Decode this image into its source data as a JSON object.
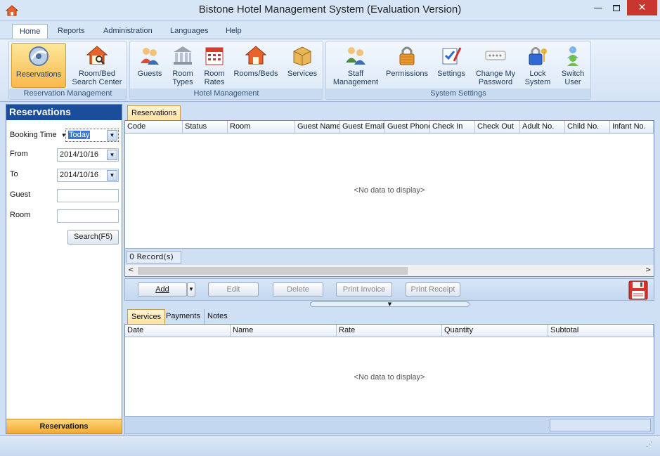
{
  "window": {
    "title": "Bistone Hotel Management System (Evaluation Version)",
    "min": "▭",
    "max": "▢",
    "close": "✕"
  },
  "menu": {
    "tabs": [
      {
        "label": "Home"
      },
      {
        "label": "Reports"
      },
      {
        "label": "Administration"
      },
      {
        "label": "Languages"
      },
      {
        "label": "Help"
      }
    ]
  },
  "ribbon": {
    "groups": [
      {
        "title": "Reservation Management",
        "buttons": [
          {
            "label": "Reservations"
          },
          {
            "label": "Room/Bed\nSearch Center"
          }
        ]
      },
      {
        "title": "Hotel Management",
        "buttons": [
          {
            "label": "Guests"
          },
          {
            "label": "Room\nTypes"
          },
          {
            "label": "Room\nRates"
          },
          {
            "label": "Rooms/Beds"
          },
          {
            "label": "Services"
          }
        ]
      },
      {
        "title": "System Settings",
        "buttons": [
          {
            "label": "Staff\nManagement"
          },
          {
            "label": "Permissions"
          },
          {
            "label": "Settings"
          },
          {
            "label": "Change My\nPassword"
          },
          {
            "label": "Lock\nSystem"
          },
          {
            "label": "Switch\nUser"
          }
        ]
      }
    ]
  },
  "left_panel": {
    "header": "Reservations",
    "booking_time_label": "Booking Time",
    "booking_time_value": "Today",
    "from_label": "From",
    "from_value": "2014/10/16",
    "to_label": "To",
    "to_value": "2014/10/16",
    "guest_label": "Guest",
    "room_label": "Room",
    "search_button": "Search(F5)",
    "footer": "Reservations"
  },
  "reservations": {
    "tab": "Reservations",
    "columns": [
      "Code",
      "Status",
      "Room",
      "Guest Name",
      "Guest Email",
      "Guest Phone",
      "Check In",
      "Check Out",
      "Adult No.",
      "Child No.",
      "Infant No."
    ],
    "no_data": "<No data to display>",
    "record_count": "0 Record(s)",
    "buttons": {
      "add": "Add",
      "edit": "Edit",
      "delete": "Delete",
      "print_invoice": "Print Invoice",
      "print_receipt": "Print Receipt"
    }
  },
  "details": {
    "tabs": [
      {
        "label": "Services"
      },
      {
        "label": "Payments"
      },
      {
        "label": "Notes"
      }
    ],
    "columns": [
      "Date",
      "Name",
      "Rate",
      "Quantity",
      "Subtotal"
    ],
    "no_data": "<No data to display>"
  },
  "colors": {
    "accent": "#1a4e9a",
    "selected": "#f9b94d",
    "close": "#c7372f"
  }
}
